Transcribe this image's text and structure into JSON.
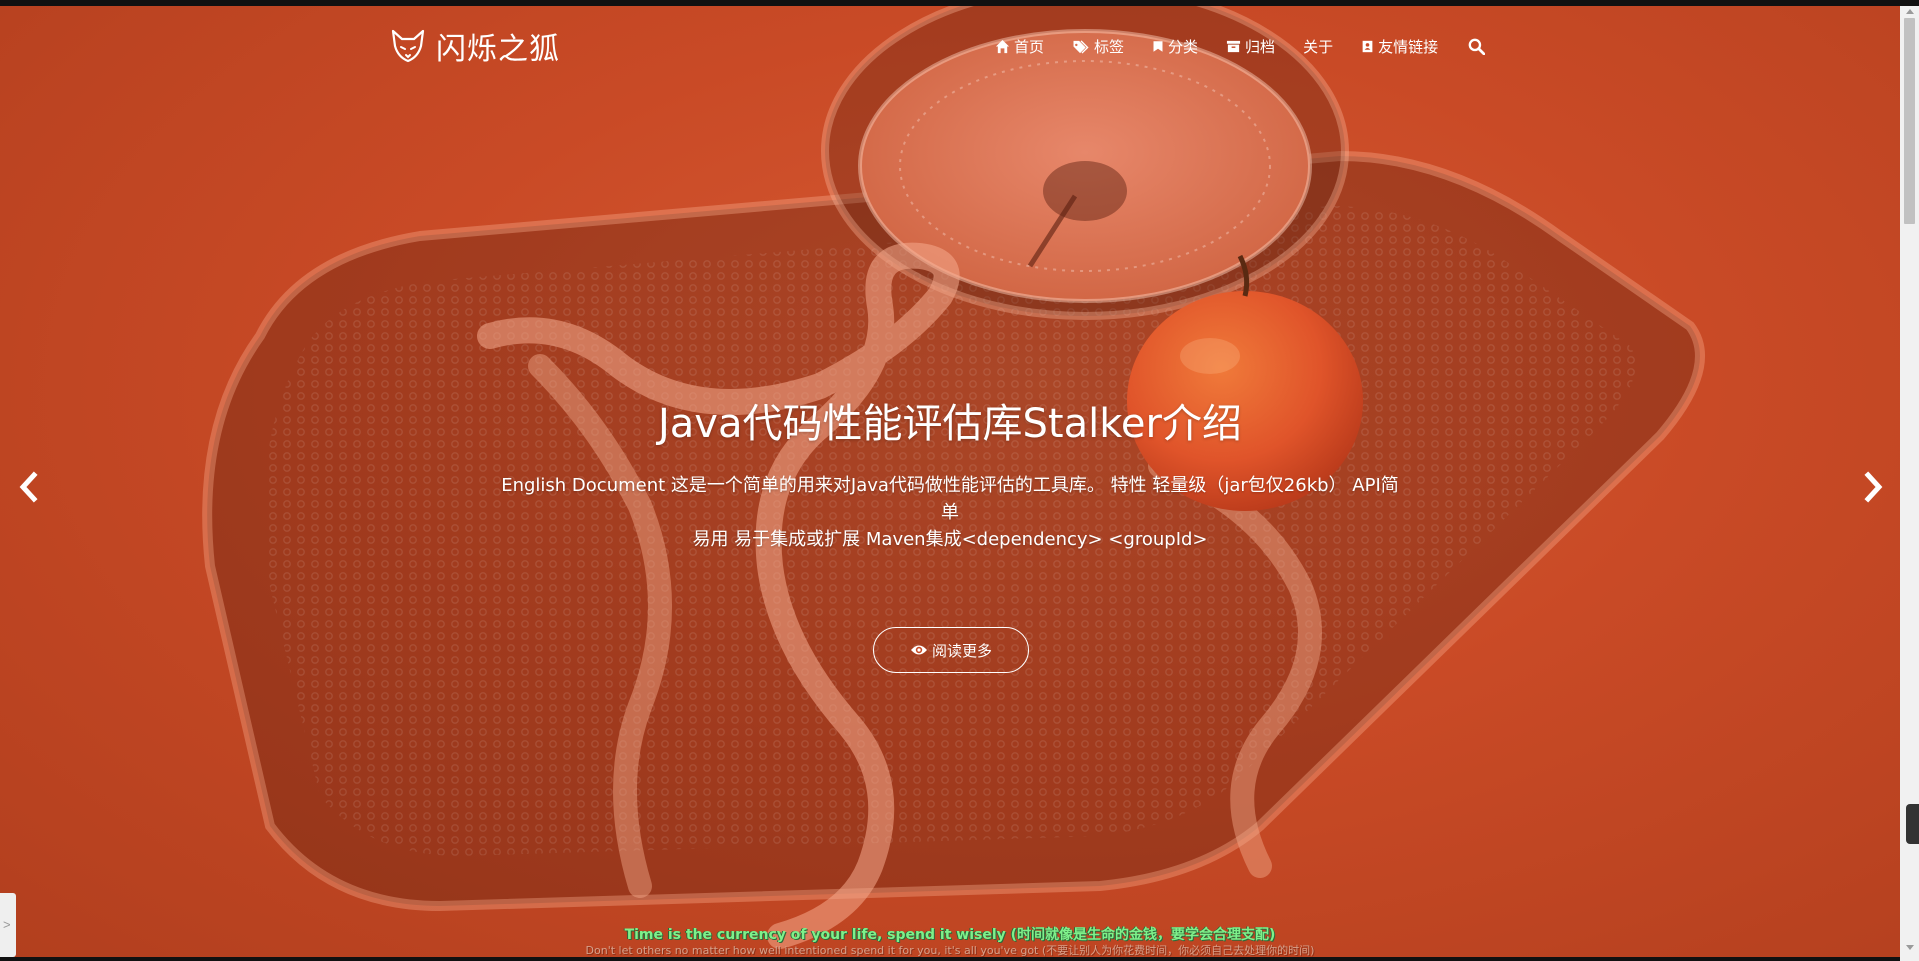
{
  "site": {
    "brand_name": "闪烁之狐",
    "logo_icon": "fox-logo-icon"
  },
  "nav": {
    "items": [
      {
        "label": "首页",
        "icon": "home-icon"
      },
      {
        "label": "标签",
        "icon": "tags-icon"
      },
      {
        "label": "分类",
        "icon": "bookmark-icon"
      },
      {
        "label": "归档",
        "icon": "archive-icon"
      },
      {
        "label": "关于",
        "icon": ""
      },
      {
        "label": "友情链接",
        "icon": "address-book-icon"
      }
    ],
    "search_icon": "search-icon"
  },
  "slide": {
    "title": "Java代码性能评估库Stalker介绍",
    "excerpt_line1": "English Document 这是一个简单的用来对Java代码做性能评估的工具库。 特性 轻量级（jar包仅26kb） API简单",
    "excerpt_line2": "易用 易于集成或扩展 Maven集成<dependency> <groupId>",
    "read_more_label": "阅读更多",
    "read_more_icon": "eye-icon"
  },
  "footer_quote": {
    "line1": "Time is the currency of your life, spend it wisely (时间就像是生命的金钱，要学会合理支配)",
    "line2": "Don't let others no matter how well intentioned spend it for you, it's all you've got (不要让别人为你花费时间，你必须自己去处理你的时间)"
  },
  "side_tab_label": ">",
  "colors": {
    "hero_overlay": "#c94a26",
    "quote_green": "#7ff08a"
  }
}
